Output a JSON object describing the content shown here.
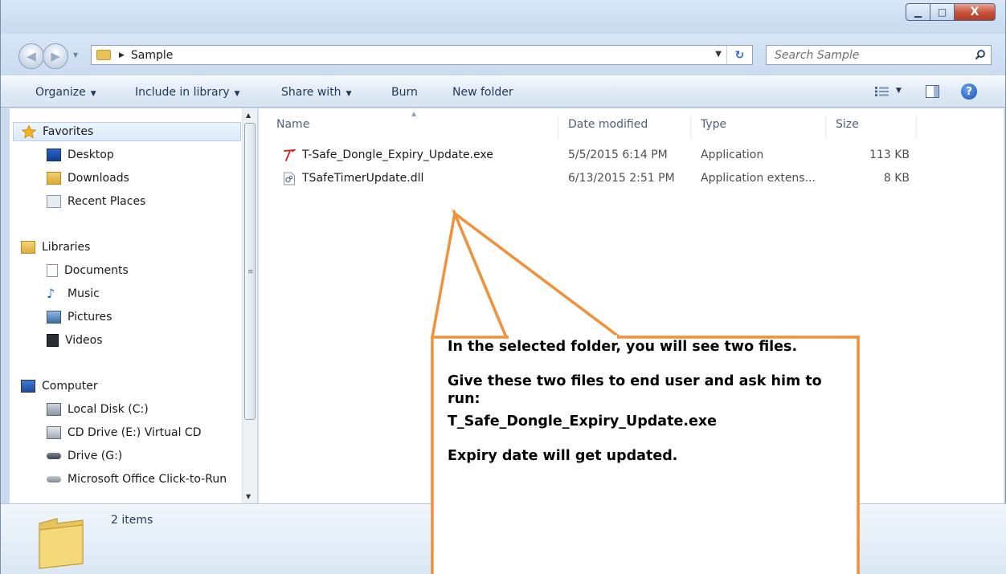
{
  "window": {
    "minimize_glyph": "▁",
    "maximize_glyph": "□",
    "close_glyph": "X"
  },
  "address": {
    "crumb": "Sample",
    "search_placeholder": "Search Sample"
  },
  "toolbar": {
    "organize": "Organize",
    "include_in_library": "Include in library",
    "share_with": "Share with",
    "burn": "Burn",
    "new_folder": "New folder"
  },
  "nav": {
    "favorites": "Favorites",
    "desktop": "Desktop",
    "downloads": "Downloads",
    "recent_places": "Recent Places",
    "libraries": "Libraries",
    "documents": "Documents",
    "music": "Music",
    "pictures": "Pictures",
    "videos": "Videos",
    "computer": "Computer",
    "local_disk": "Local Disk (C:)",
    "cd_drive": "CD Drive (E:) Virtual CD",
    "drive_g": "Drive (G:)",
    "office": "Microsoft Office Click-to-Run"
  },
  "columns": {
    "name": "Name",
    "date_modified": "Date modified",
    "type": "Type",
    "size": "Size"
  },
  "files": [
    {
      "name": "T-Safe_Dongle_Expiry_Update.exe",
      "date": "5/5/2015 6:14 PM",
      "type": "Application",
      "size": "113 KB"
    },
    {
      "name": "TSafeTimerUpdate.dll",
      "date": "6/13/2015 2:51 PM",
      "type": "Application extens...",
      "size": "8 KB"
    }
  ],
  "details": {
    "items_count": "2 items"
  },
  "callout": {
    "line1": "In the selected folder, you will see two files.",
    "line2": "Give these two files to end user and ask him to run:",
    "line3": "T_Safe_Dongle_Expiry_Update.exe",
    "line4": "Expiry date will get updated."
  },
  "colors": {
    "callout_border": "#f0923c",
    "accent": "#1e395b"
  }
}
